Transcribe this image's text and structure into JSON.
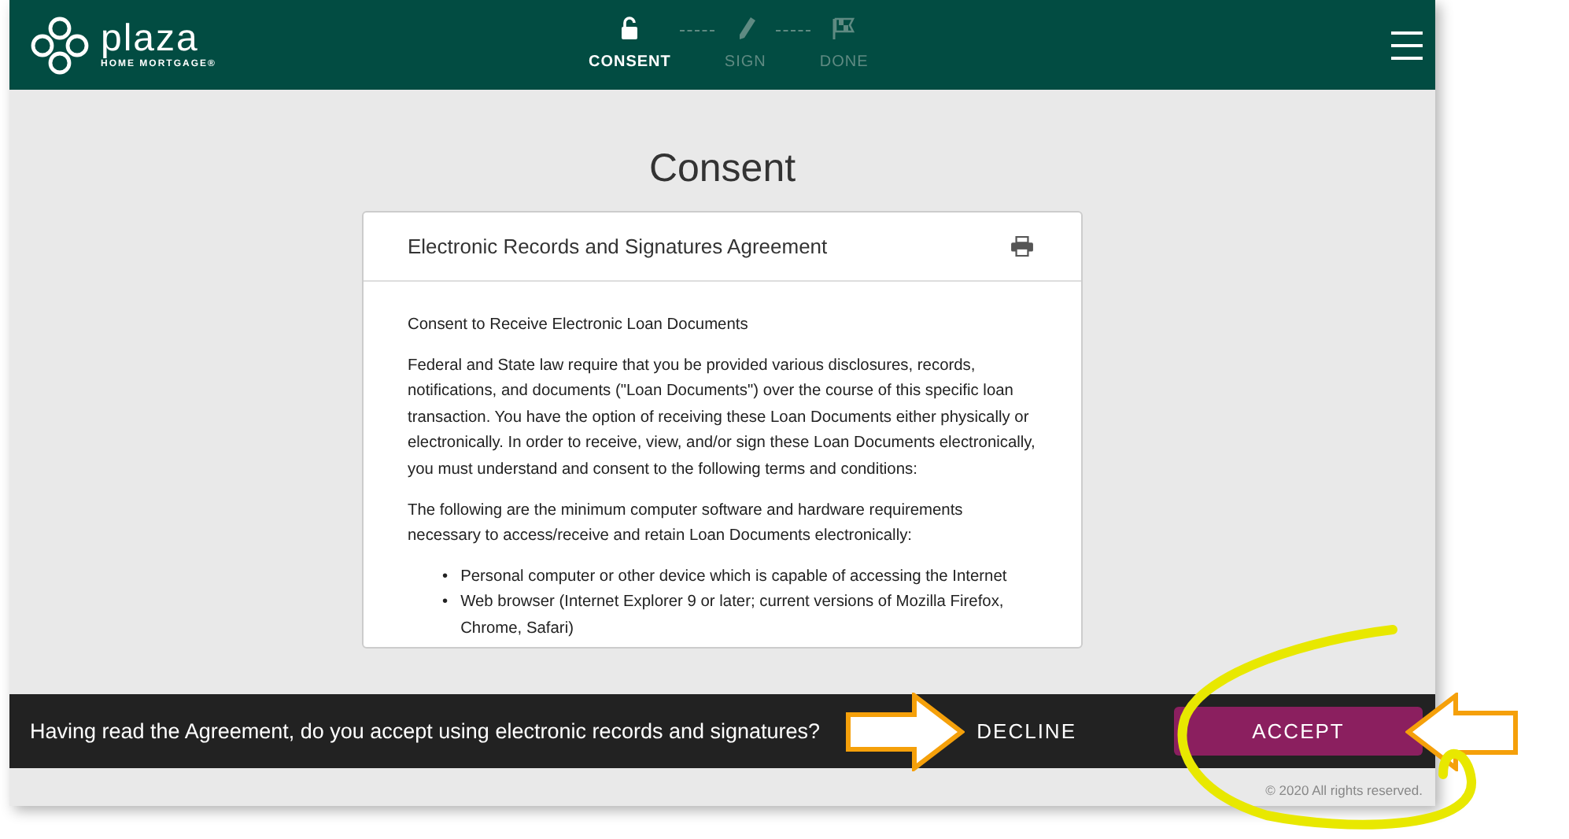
{
  "header": {
    "logo": {
      "name": "plaza",
      "tagline": "HOME MORTGAGE®"
    },
    "steps": [
      {
        "label": "CONSENT",
        "kind": "lock",
        "active": true
      },
      {
        "label": "SIGN",
        "kind": "pen",
        "active": false
      },
      {
        "label": "DONE",
        "kind": "flag",
        "active": false
      }
    ]
  },
  "page_title": "Consent",
  "card": {
    "title": "Electronic Records and Signatures Agreement",
    "heading": "Consent to Receive Electronic Loan Documents",
    "paragraphs": [
      "Federal and State law require that you be provided various disclosures, records, notifications, and documents (\"Loan Documents\") over the course of this specific loan transaction. You have the option of receiving these Loan Documents either physically or electronically. In order to receive, view, and/or sign these Loan Documents electronically, you must understand and consent to the following terms and conditions:",
      "The following are the minimum computer software and hardware requirements necessary to access/receive and retain Loan Documents electronically:"
    ],
    "bullets": [
      {
        "marker": "•",
        "text": "Personal computer or other device which is capable of accessing the Internet"
      },
      {
        "marker": "•",
        "text": "Web browser (Internet Explorer 9 or later; current versions of Mozilla Firefox, Chrome, Safari)"
      }
    ]
  },
  "consent_bar": {
    "question": "Having read the Agreement, do you accept using electronic records and signatures?",
    "decline": "DECLINE",
    "accept": "ACCEPT"
  },
  "footer": "© 2020  All rights reserved."
}
